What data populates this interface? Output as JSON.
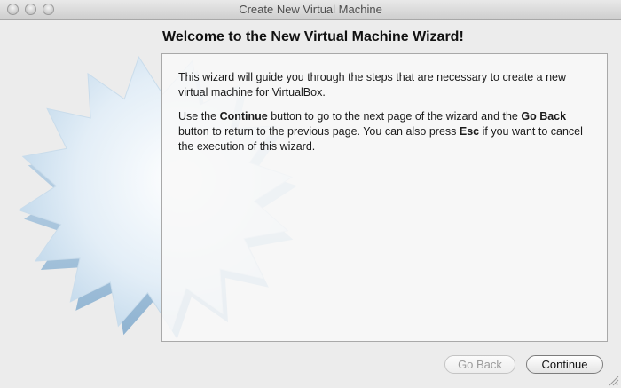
{
  "window": {
    "title": "Create New Virtual Machine"
  },
  "wizard": {
    "heading": "Welcome to the New Virtual Machine Wizard!",
    "paragraph1": {
      "text": "This wizard will guide you through the steps that are necessary to create a new virtual machine for VirtualBox."
    },
    "paragraph2": {
      "part1": "Use the ",
      "bold1": "Continue",
      "part2": " button to go to the next page of the wizard and the ",
      "bold2": "Go Back",
      "part3": " button to return to the previous page. You can also press ",
      "bold3": "Esc",
      "part4": " if you want to cancel the execution of this wizard."
    }
  },
  "buttons": {
    "back_label": "Go Back",
    "back_enabled": false,
    "continue_label": "Continue"
  },
  "icons": {
    "close": "close-icon",
    "minimize": "minimize-icon",
    "zoom": "zoom-icon",
    "decoration": "starburst-graphic",
    "resize": "resize-grip-icon"
  }
}
